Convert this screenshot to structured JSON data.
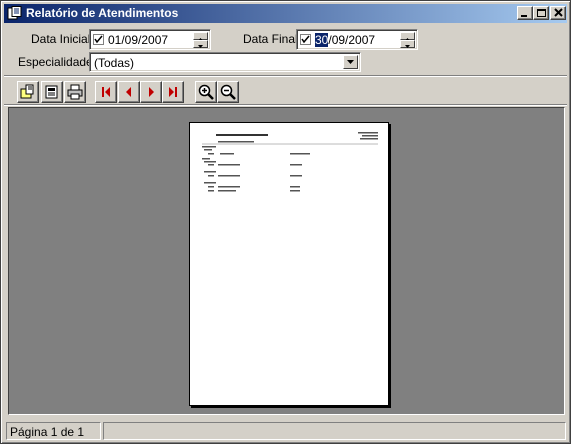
{
  "window": {
    "title": "Relatório de Atendimentos"
  },
  "filters": {
    "start_date_label": "Data Inicial:",
    "start_date_value": "01/09/2007",
    "end_date_label": "Data Final:",
    "end_date_day": "30",
    "end_date_rest": "/09/2007",
    "specialty_label": "Especialidade:",
    "specialty_value": "(Todas)"
  },
  "toolbar": {
    "buttons": [
      "open-report-icon",
      "save-report-icon",
      "print-icon",
      "first-page-icon",
      "previous-page-icon",
      "next-page-icon",
      "last-page-icon",
      "zoom-in-icon",
      "zoom-out-icon"
    ]
  },
  "status": {
    "page_info": "Página 1 de 1"
  },
  "colors": {
    "title_start": "#0a246a",
    "title_end": "#a6caf0",
    "nav_red": "#c00000",
    "preview_bg": "#808080"
  }
}
